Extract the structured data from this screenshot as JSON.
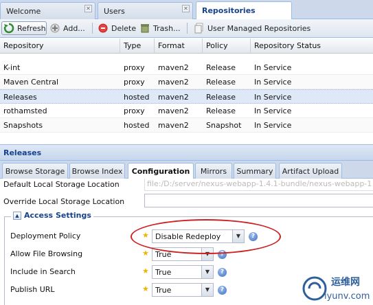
{
  "top_tabs": [
    {
      "label": "Welcome"
    },
    {
      "label": "Users"
    },
    {
      "label": "Repositories"
    }
  ],
  "toolbar": {
    "refresh": "Refresh",
    "add": "Add...",
    "delete": "Delete",
    "trash": "Trash...",
    "user_managed": "User Managed Repositories"
  },
  "grid": {
    "columns": [
      "Repository",
      "Type",
      "Format",
      "Policy",
      "Repository Status"
    ],
    "rows": [
      {
        "name": "K-int",
        "type": "proxy",
        "format": "maven2",
        "policy": "Release",
        "status": "In Service"
      },
      {
        "name": "Maven Central",
        "type": "proxy",
        "format": "maven2",
        "policy": "Release",
        "status": "In Service"
      },
      {
        "name": "Releases",
        "type": "hosted",
        "format": "maven2",
        "policy": "Release",
        "status": "In Service"
      },
      {
        "name": "rothamsted",
        "type": "proxy",
        "format": "maven2",
        "policy": "Release",
        "status": "In Service"
      },
      {
        "name": "Snapshots",
        "type": "hosted",
        "format": "maven2",
        "policy": "Snapshot",
        "status": "In Service"
      }
    ]
  },
  "section_title": "Releases",
  "sub_tabs": [
    "Browse Storage",
    "Browse Index",
    "Configuration",
    "Mirrors",
    "Summary",
    "Artifact Upload"
  ],
  "form": {
    "default_storage_label": "Default Local Storage Location",
    "default_storage_value": "file:/D:/server/nexus-webapp-1.4.1-bundle/nexus-webapp-1",
    "override_storage_label": "Override Local Storage Location",
    "access_settings": "Access Settings",
    "deployment_policy_label": "Deployment Policy",
    "deployment_policy_value": "Disable Redeploy",
    "allow_file_browsing_label": "Allow File Browsing",
    "allow_file_browsing_value": "True",
    "include_in_search_label": "Include in Search",
    "include_in_search_value": "True",
    "publish_url_label": "Publish URL",
    "publish_url_value": "True"
  },
  "watermark": {
    "top": "运维网",
    "bottom": "iyunv.com"
  },
  "colors": {
    "accent": "#15428b",
    "highlight_ellipse": "#cc2222",
    "star": "#f0b400"
  }
}
